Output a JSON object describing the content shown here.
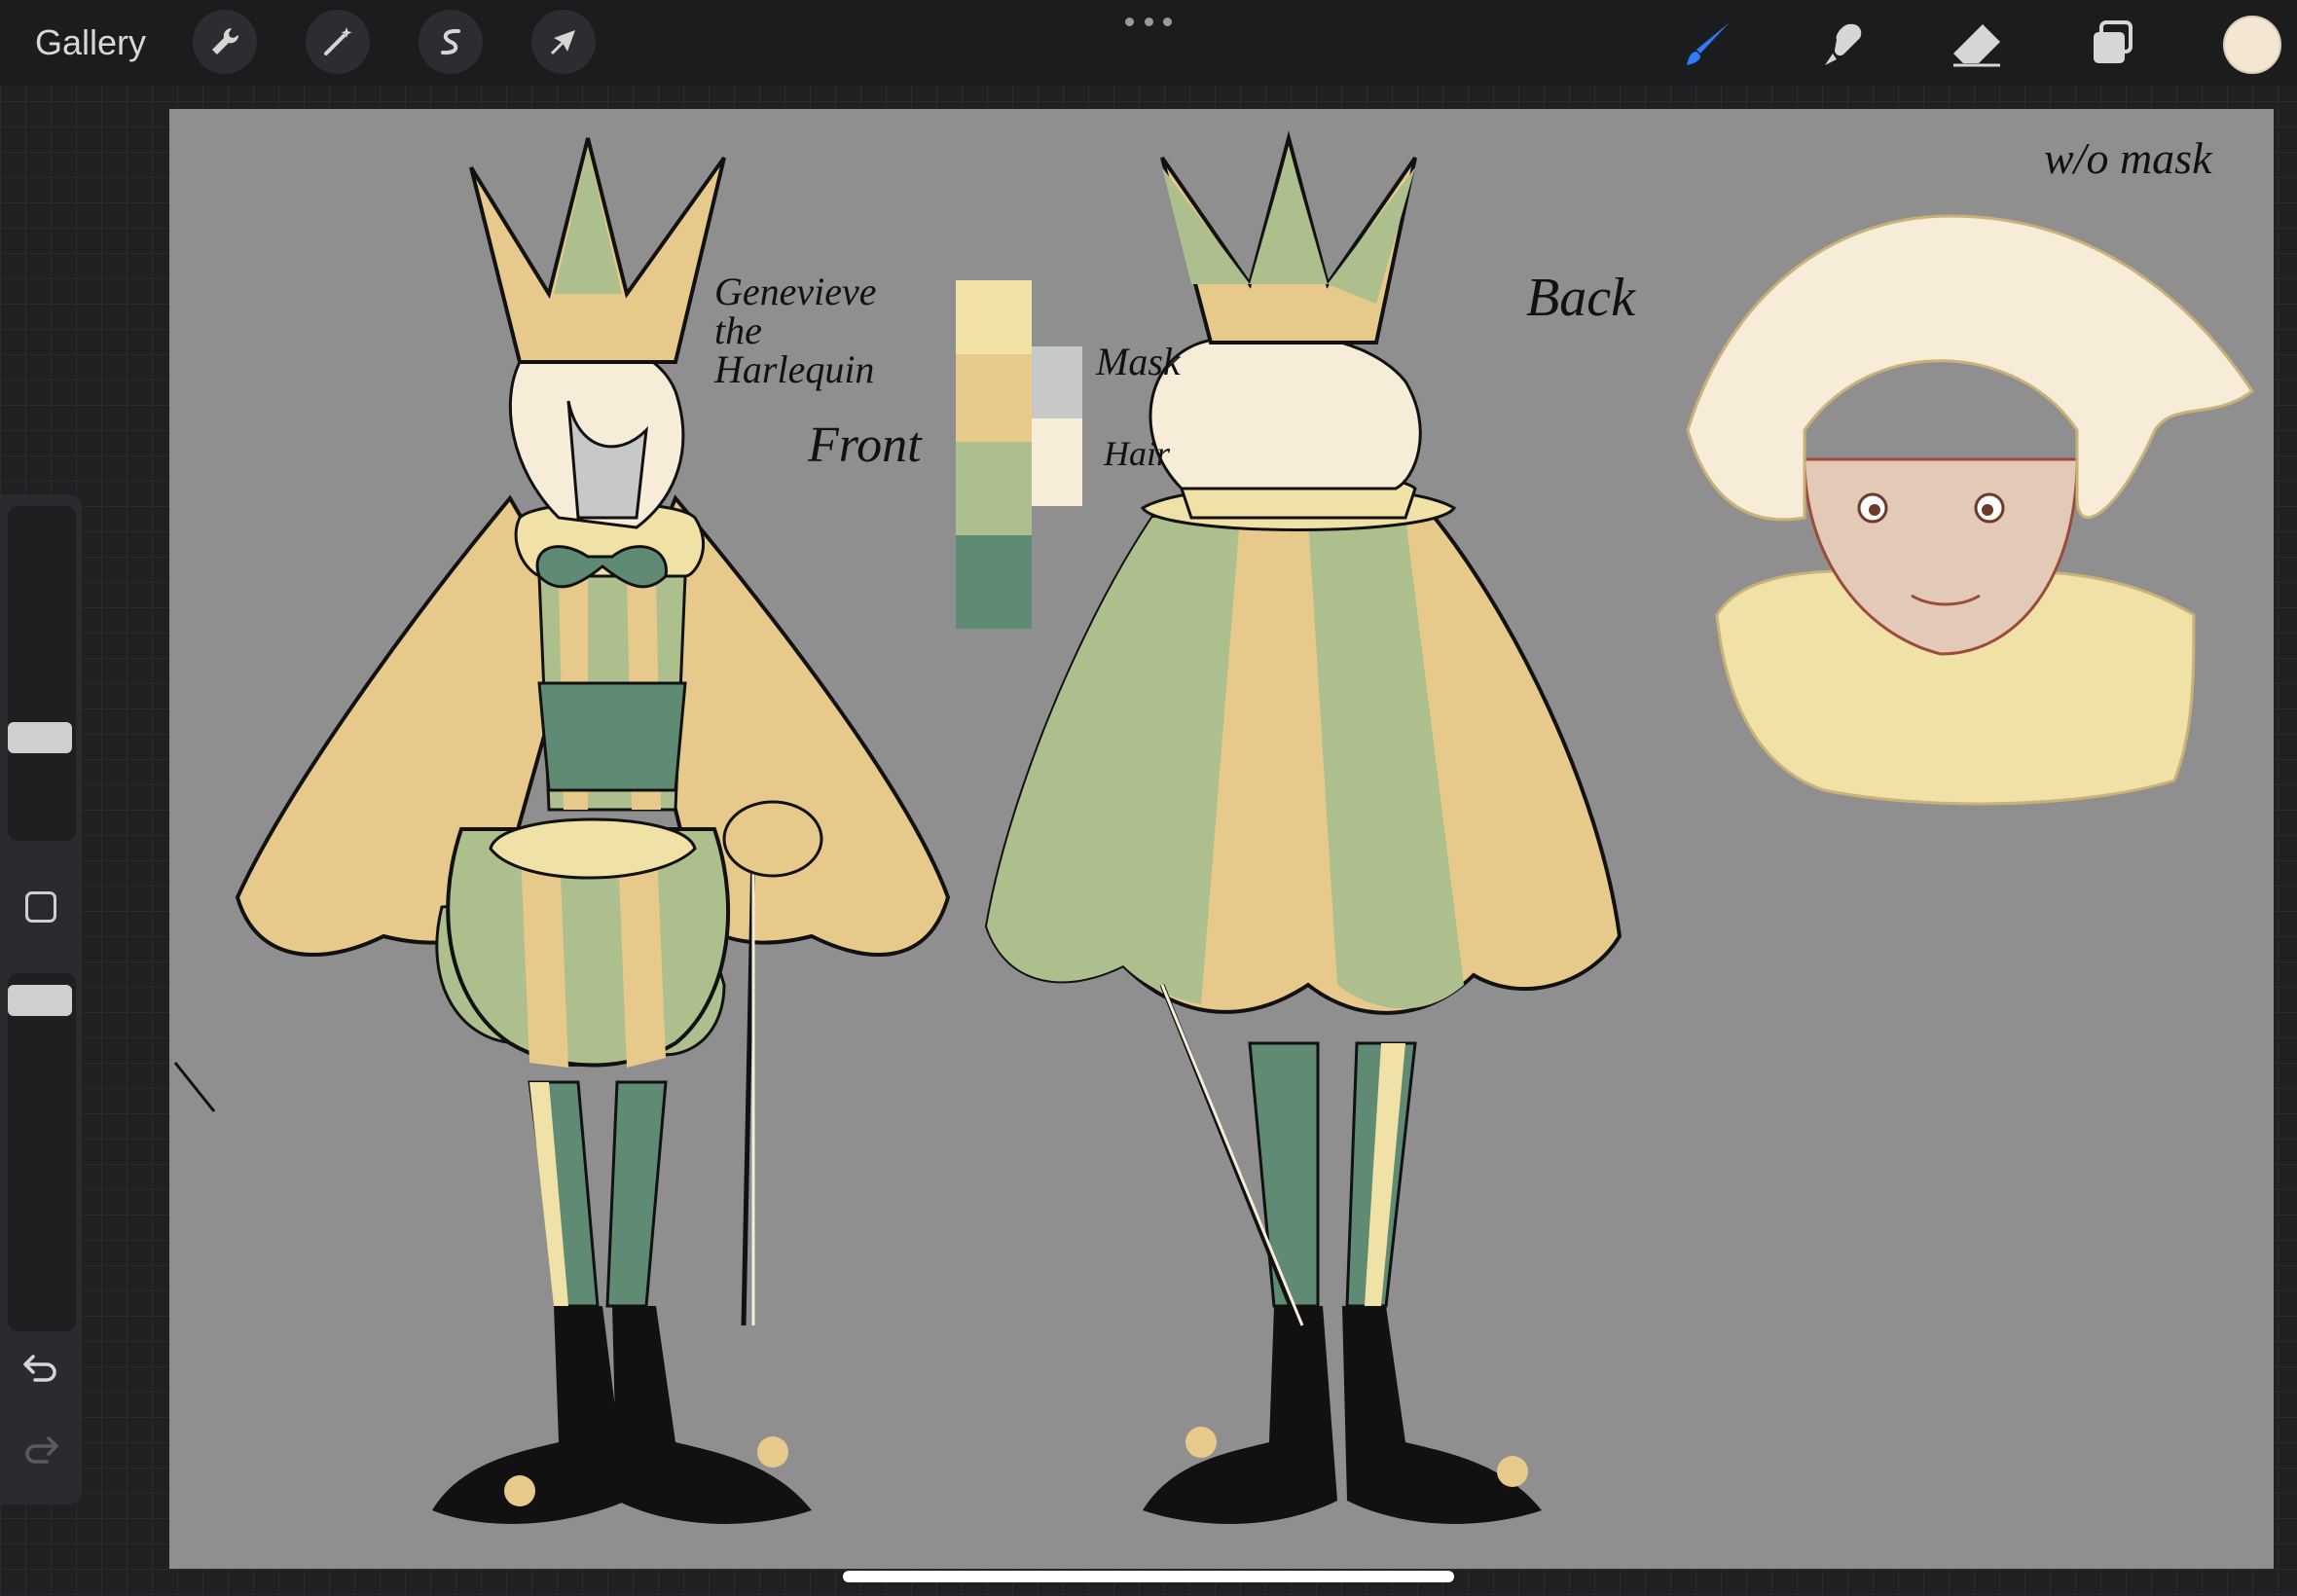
{
  "topbar": {
    "gallery_label": "Gallery",
    "left_tools": [
      {
        "icon": "wrench-icon",
        "label": "Actions"
      },
      {
        "icon": "magic-wand-icon",
        "label": "Adjustments"
      },
      {
        "icon": "selection-icon",
        "label": "Selection"
      },
      {
        "icon": "arrow-cursor-icon",
        "label": "Transform"
      }
    ],
    "right_tools": [
      {
        "icon": "brush-icon",
        "active": true
      },
      {
        "icon": "smudge-icon",
        "active": false
      },
      {
        "icon": "eraser-icon",
        "active": false
      },
      {
        "icon": "layers-icon",
        "active": false
      }
    ],
    "current_color": "#f3e6d2",
    "active_tool_color": "#2f7bf6"
  },
  "sidebar": {
    "brush_size": 0.7,
    "opacity": 1.0
  },
  "canvas": {
    "background": "#8f8f8f",
    "annotations": {
      "title": "Genevieve\nthe\nHarlequin",
      "front": "Front",
      "back": "Back",
      "mask": "Mask",
      "hair": "Hair",
      "without_mask": "w/o mask"
    },
    "palette": [
      "#f0e1a6",
      "#e7c98c",
      "#aebf8e",
      "#5f8a73",
      "#c7c9c9",
      "#f6ecd8"
    ]
  }
}
